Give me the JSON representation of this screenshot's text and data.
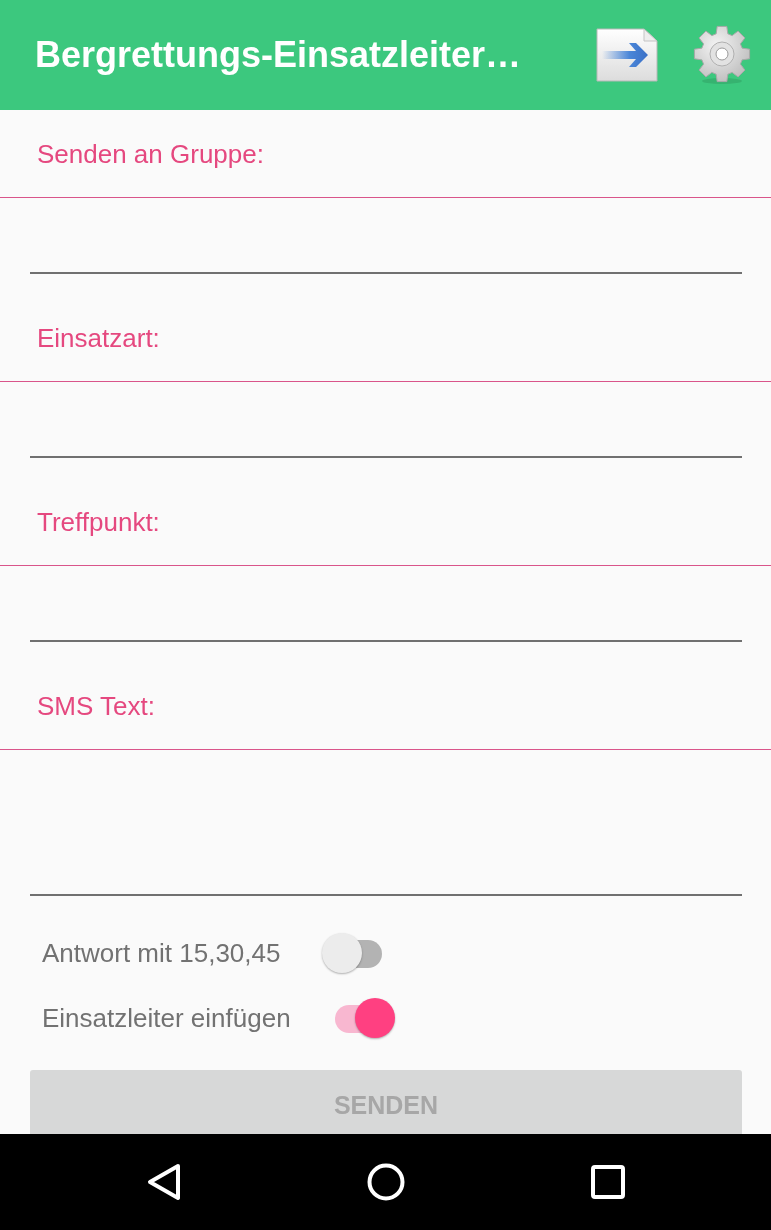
{
  "app_bar": {
    "title": "Bergrettungs-Einsatzleiter…"
  },
  "form": {
    "sections": [
      {
        "label": "Senden an Gruppe:",
        "kind": "single"
      },
      {
        "label": "Einsatzart:",
        "kind": "single"
      },
      {
        "label": "Treffpunkt:",
        "kind": "single"
      },
      {
        "label": "SMS Text:",
        "kind": "multiline"
      }
    ]
  },
  "switches": [
    {
      "label": "Antwort mit 15,30,45",
      "on": false
    },
    {
      "label": "Einsatzleiter einfügen",
      "on": true
    }
  ],
  "send_button": {
    "label": "SENDEN",
    "disabled": true
  }
}
